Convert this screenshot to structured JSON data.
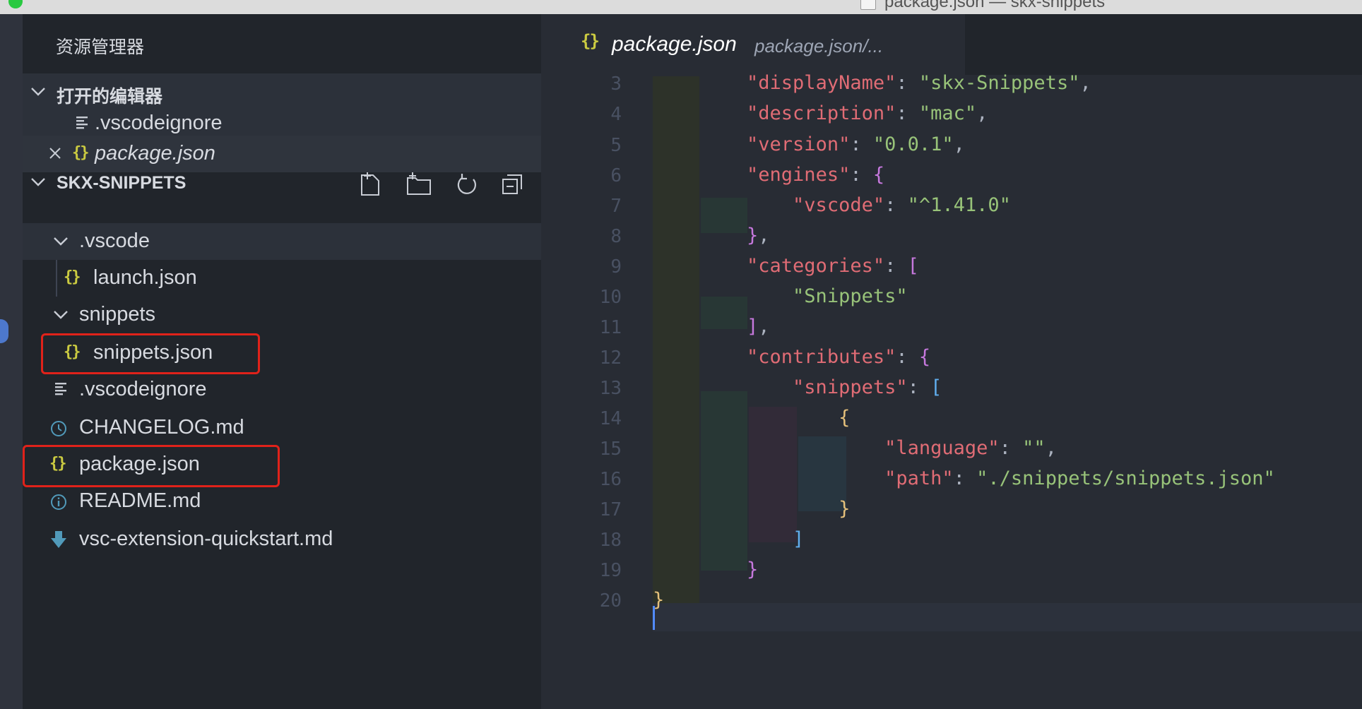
{
  "window": {
    "title": "package.json — skx-snippets"
  },
  "sidebar": {
    "header": "资源管理器",
    "open_editors": {
      "label": "打开的编辑器",
      "items": [
        {
          "name": ".vscodeignore",
          "icon": "lines-icon",
          "italic": false
        },
        {
          "name": "package.json",
          "icon": "json-braces-icon",
          "italic": true,
          "close": "close-icon"
        }
      ]
    },
    "project": {
      "label": "SKX-SNIPPETS",
      "toolbar": [
        "new-file-icon",
        "new-folder-icon",
        "refresh-icon",
        "collapse-all-icon"
      ],
      "items": [
        {
          "name": ".vscode",
          "type": "folder",
          "expanded": true
        },
        {
          "name": "launch.json",
          "type": "json"
        },
        {
          "name": "snippets",
          "type": "folder",
          "expanded": true
        },
        {
          "name": "snippets.json",
          "type": "json",
          "highlighted": true
        },
        {
          "name": ".vscodeignore",
          "type": "text"
        },
        {
          "name": "CHANGELOG.md",
          "type": "changelog"
        },
        {
          "name": "package.json",
          "type": "json",
          "highlighted": true
        },
        {
          "name": "README.md",
          "type": "info"
        },
        {
          "name": "vsc-extension-quickstart.md",
          "type": "download"
        }
      ]
    }
  },
  "editor": {
    "tab": {
      "name": "package.json",
      "path": "package.json/..."
    },
    "line_numbers": [
      "3",
      "4",
      "5",
      "6",
      "7",
      "8",
      "9",
      "10",
      "11",
      "12",
      "13",
      "14",
      "15",
      "16",
      "17",
      "18",
      "19",
      "20"
    ],
    "code": {
      "l3": {
        "indent": "    ",
        "key": "\"displayName\"",
        "colon": ": ",
        "value": "\"skx-Snippets\"",
        "end": ","
      },
      "l4": {
        "indent": "    ",
        "key": "\"description\"",
        "colon": ": ",
        "value": "\"mac\"",
        "end": ","
      },
      "l5": {
        "indent": "    ",
        "key": "\"version\"",
        "colon": ": ",
        "value": "\"0.0.1\"",
        "end": ","
      },
      "l6": {
        "indent": "    ",
        "key": "\"engines\"",
        "colon": ": ",
        "bracket": "{"
      },
      "l7": {
        "indent": "        ",
        "key": "\"vscode\"",
        "colon": ": ",
        "value": "\"^1.41.0\""
      },
      "l8": {
        "indent": "    ",
        "bracket": "}",
        "end": ","
      },
      "l9": {
        "indent": "    ",
        "key": "\"categories\"",
        "colon": ": ",
        "bracket": "["
      },
      "l10": {
        "indent": "        ",
        "value": "\"Snippets\""
      },
      "l11": {
        "indent": "    ",
        "bracket": "]",
        "end": ","
      },
      "l12": {
        "indent": "    ",
        "key": "\"contributes\"",
        "colon": ": ",
        "bracket": "{"
      },
      "l13": {
        "indent": "        ",
        "key": "\"snippets\"",
        "colon": ": ",
        "bracket": "["
      },
      "l14": {
        "indent": "            ",
        "bracket": "{"
      },
      "l15": {
        "indent": "                ",
        "key": "\"language\"",
        "colon": ": ",
        "value": "\"\"",
        "end": ","
      },
      "l16": {
        "indent": "                ",
        "key": "\"path\"",
        "colon": ": ",
        "value": "\"./snippets/snippets.json\""
      },
      "l17": {
        "indent": "            ",
        "bracket": "}"
      },
      "l18": {
        "indent": "        ",
        "bracket": "]"
      },
      "l19": {
        "indent": "    ",
        "bracket": "}"
      },
      "l20": {
        "indent": "",
        "bracket": "}"
      }
    }
  },
  "colors": {
    "sidebar_bg": "#21252b",
    "editor_bg": "#282c34",
    "highlight_box": "#e0221a",
    "json_icon": "#cbcb41",
    "key": "#e06c75",
    "string": "#98c379"
  }
}
